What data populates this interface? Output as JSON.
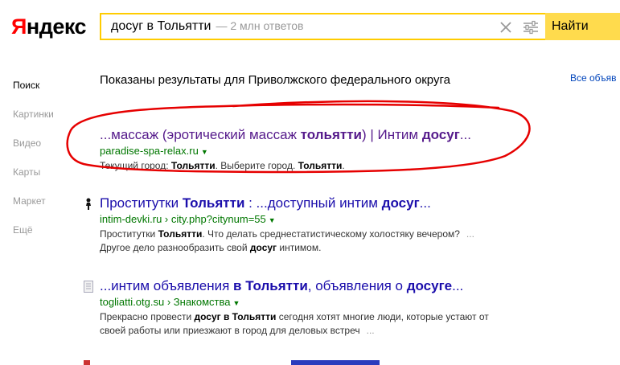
{
  "logo": {
    "first": "Я",
    "rest": "ндекс"
  },
  "search": {
    "query": "досуг в Тольятти",
    "hint": "— 2 млн ответов",
    "button_label": "Найти"
  },
  "sidebar": {
    "items": [
      {
        "label": "Поиск"
      },
      {
        "label": "Картинки"
      },
      {
        "label": "Видео"
      },
      {
        "label": "Карты"
      },
      {
        "label": "Маркет"
      },
      {
        "label": "Ещё"
      }
    ]
  },
  "region_notice": "Показаны результаты для Приволжского федерального округа",
  "all_ads": "Все объяв",
  "results": [
    {
      "title_parts": [
        "...массаж (эротический массаж ",
        "тольятти",
        ") | Интим ",
        "досуг",
        "..."
      ],
      "url": "paradise-spa-relax.ru",
      "url_path": "",
      "snippet_parts": [
        "Текущий город: ",
        "Тольятти",
        ". Выберите город. ",
        "Тольятти",
        "."
      ]
    },
    {
      "title_parts": [
        "Проститутки ",
        "Тольятти",
        " : ...доступный интим ",
        "досуг",
        "..."
      ],
      "url": "intim-devki.ru",
      "url_path": "city.php?citynum=55",
      "snippet_line1": [
        "Проститутки ",
        "Тольятти",
        ". Что делать среднестатистическому холостяку вечером?",
        "..."
      ],
      "snippet_line2": [
        "Другое дело разнообразить свой ",
        "досуг",
        " интимом."
      ]
    },
    {
      "title_parts": [
        "...интим объявления ",
        "в Тольятти",
        ", объявления о ",
        "досуге",
        "..."
      ],
      "url": "togliatti.otg.su",
      "url_path": "Знакомства",
      "snippet_line1": [
        "Прекрасно провести ",
        "досуг в Тольятти",
        " сегодня хотят многие люди, которые устают от"
      ],
      "snippet_line2": [
        "своей работы или приезжают в город для деловых встреч",
        "..."
      ]
    }
  ],
  "colors": {
    "accent": "#ffdb4d",
    "link": "#1a0dab",
    "visited": "#551a8b",
    "url_green": "#007700",
    "annotation_red": "#e60000"
  },
  "icons": [
    "clear-icon",
    "filter-settings-icon",
    "favicon-figure-icon",
    "favicon-page-icon"
  ]
}
